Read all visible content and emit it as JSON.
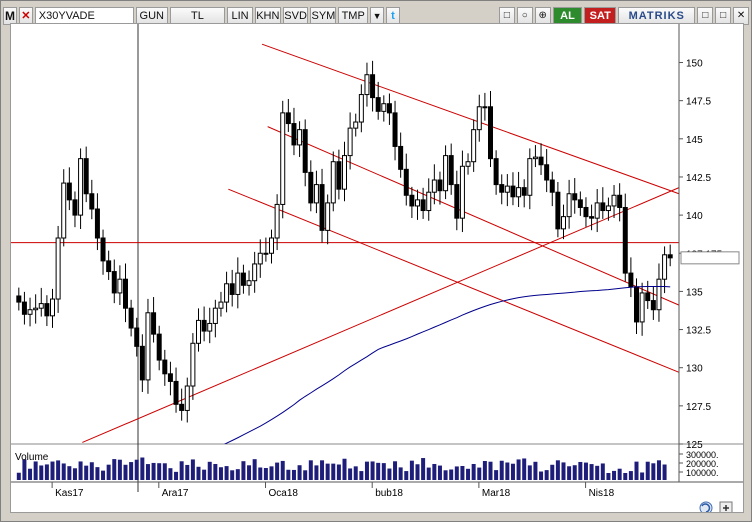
{
  "toolbar": {
    "app_icon": "M",
    "close_symbol": "✕",
    "symbol": "X30YVADE",
    "period": "GUN",
    "currency": "TL",
    "scale": "LIN",
    "tools": [
      "KHN",
      "SVD",
      "SYM",
      "TMP"
    ],
    "dropdown": "▼",
    "twitter_icon": "t",
    "icons": [
      "□",
      "○",
      "⊕"
    ],
    "buy_label": "AL",
    "sell_label": "SAT",
    "brand": "MATRIKS",
    "window_buttons": [
      "□",
      "□",
      "✕"
    ]
  },
  "colors": {
    "candle": "#000000",
    "trendline": "#cc0000",
    "moving_average": "#00008b",
    "volume": "#1e1e7a",
    "horizontal_line": "#cc0000",
    "buy": "#2d8a2d",
    "sell": "#c41f1f"
  },
  "chart_data": {
    "type": "candlestick",
    "symbol": "X30YVADE",
    "y_ticks": [
      125,
      127.5,
      130,
      132.5,
      135,
      137.5,
      140,
      142.5,
      145,
      147.5,
      150
    ],
    "y_tick_labels": [
      "125",
      "127.5",
      "130",
      "132.5",
      "135",
      "137.175",
      "140",
      "142.5",
      "145",
      "147.5",
      "150"
    ],
    "ylim": [
      125,
      152
    ],
    "last_price": "137.175",
    "x_month_labels": [
      "Kas17",
      "Ara17",
      "Oca18",
      "bub18",
      "Mar18",
      "Nis18"
    ],
    "volume_label": "Volume",
    "volume_ticks": [
      "300000.",
      "200000.",
      "100000."
    ],
    "closes": [
      134.3,
      133.5,
      133.8,
      133.9,
      134.2,
      133.4,
      134.5,
      138.5,
      142.1,
      141.0,
      140.0,
      143.7,
      141.4,
      140.4,
      138.5,
      137.0,
      136.3,
      134.9,
      135.8,
      133.9,
      132.6,
      131.4,
      129.2,
      133.6,
      132.2,
      130.5,
      129.6,
      129.1,
      127.6,
      127.2,
      128.8,
      131.6,
      133.1,
      132.4,
      132.9,
      133.9,
      134.3,
      135.5,
      134.8,
      136.2,
      135.4,
      135.7,
      136.8,
      137.5,
      137.5,
      138.5,
      140.7,
      146.7,
      146.0,
      144.6,
      145.6,
      142.8,
      140.8,
      142.0,
      139.0,
      140.8,
      143.5,
      141.7,
      143.9,
      145.7,
      146.1,
      147.9,
      149.2,
      147.7,
      146.8,
      147.3,
      146.7,
      144.5,
      143.0,
      141.3,
      140.6,
      141.0,
      140.3,
      141.5,
      142.3,
      141.6,
      143.9,
      142.0,
      139.8,
      143.2,
      143.5,
      145.6,
      147.1,
      147.1,
      143.7,
      142.0,
      141.5,
      141.9,
      141.2,
      141.8,
      141.3,
      143.7,
      143.8,
      143.3,
      142.3,
      141.5,
      139.1,
      139.9,
      141.4,
      141.0,
      140.5,
      139.9,
      139.8,
      140.8,
      140.3,
      140.6,
      141.3,
      140.5,
      136.2,
      135.3,
      133.0,
      134.9,
      134.4,
      133.8,
      135.8,
      137.4,
      137.2
    ],
    "sma": [
      null,
      null,
      null,
      null,
      null,
      null,
      null,
      null,
      null,
      null,
      null,
      null,
      null,
      null,
      null,
      null,
      null,
      null,
      null,
      null,
      null,
      null,
      null,
      null,
      null,
      null,
      null,
      null,
      null,
      null,
      null,
      null,
      null,
      null,
      null,
      124.68,
      124.87,
      125.05,
      125.23,
      125.41,
      125.6,
      125.79,
      125.98,
      126.17,
      126.38,
      126.6,
      126.83,
      127.07,
      127.32,
      127.58,
      127.87,
      128.12,
      128.35,
      128.59,
      128.81,
      129.04,
      129.28,
      129.53,
      129.8,
      130.05,
      130.27,
      130.5,
      130.72,
      130.97,
      131.2,
      131.35,
      131.48,
      131.62,
      131.75,
      131.89,
      132.04,
      132.2,
      132.35,
      132.5,
      132.66,
      132.81,
      132.97,
      133.13,
      133.28,
      133.45,
      133.6,
      133.75,
      133.89,
      134.02,
      134.14,
      134.25,
      134.35,
      134.44,
      134.52,
      134.59,
      134.65,
      134.7,
      134.74,
      134.77,
      134.8,
      134.83,
      134.86,
      134.89,
      134.92,
      134.95,
      134.99,
      135.02,
      135.04,
      135.06,
      135.09,
      135.12,
      135.16,
      135.2,
      135.24,
      135.27,
      135.3,
      135.31,
      135.32,
      135.32,
      135.32,
      135.32,
      135.3
    ],
    "volume": [
      83000,
      236000,
      129000,
      212000,
      166000,
      178000,
      211000,
      224000,
      189000,
      158000,
      134000,
      212000,
      164000,
      203000,
      147000,
      107000,
      175000,
      239000,
      232000,
      174000,
      205000,
      232000,
      257000,
      182000,
      195000,
      192000,
      191000,
      135000,
      93000,
      214000,
      172000,
      235000,
      151000,
      118000,
      208000,
      183000,
      146000,
      159000,
      111000,
      124000,
      215000,
      168000,
      238000,
      143000,
      137000,
      156000,
      199000,
      218000,
      117000,
      115000,
      169000,
      111000,
      225000,
      167000,
      225000,
      187000,
      187000,
      177000,
      243000,
      132000,
      156000,
      102000,
      210000,
      212000,
      196000,
      193000,
      131000,
      214000,
      144000,
      102000,
      221000,
      180000,
      251000,
      142000,
      183000,
      165000,
      111000,
      120000,
      155000,
      160000,
      128000,
      183000,
      142000,
      217000,
      209000,
      113000,
      220000,
      200000,
      186000,
      235000,
      246000,
      167000,
      208000,
      97000,
      113000,
      174000,
      225000,
      201000,
      157000,
      169000,
      206000,
      199000,
      182000,
      162000,
      189000,
      80000,
      104000,
      129000,
      80000,
      102000,
      210000,
      86000,
      209000,
      191000,
      225000,
      177000
    ]
  }
}
